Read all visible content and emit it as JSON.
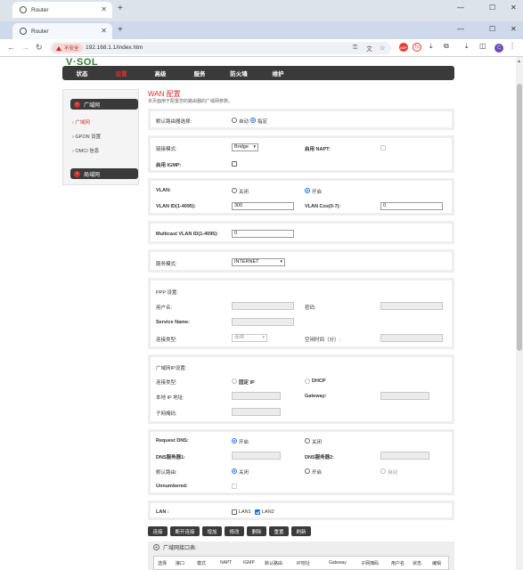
{
  "browser": {
    "tab_title": "Router",
    "url": "192.168.1.1/index.htm",
    "insecure_label": "不安全",
    "profile_initial": "C"
  },
  "router": {
    "logo": "V·SOL",
    "nav": [
      "状态",
      "设置",
      "高级",
      "服务",
      "防火墙",
      "维护"
    ],
    "sidebar": {
      "wan_header": "广域网",
      "items": [
        "广域网",
        "GPON 设置",
        "OMCI 信息"
      ],
      "lan_header": "局域网"
    },
    "page_title": "WAN 配置",
    "page_subtitle": "本页面用于配置您的路由器的广域网参数。",
    "default_route": {
      "label": "默认路由器选择:",
      "options": [
        "自动",
        "指定"
      ],
      "selected": "指定"
    },
    "mode": {
      "label": "链接模式:",
      "value": "Bridge",
      "napt_label": "启用 NAPT:",
      "igmp_label": "启用 IGMP:"
    },
    "vlan": {
      "label": "VLAN:",
      "off": "关闭",
      "on": "开启",
      "id_label": "VLAN ID(1-4095):",
      "id_value": "300",
      "cos_label": "VLAN Cos(0-7):",
      "cos_value": "0"
    },
    "multicast": {
      "label": "Multicast VLAN ID(1-4095):",
      "value": "0"
    },
    "service": {
      "label": "服务模式:",
      "value": "INTERNET"
    },
    "ppp": {
      "heading": "PPP 设置:",
      "user_label": "用户名:",
      "pass_label": "密码:",
      "service_name_label": "Service Name:",
      "conn_type_label": "连接类型:",
      "conn_type_value": "连续",
      "idle_label": "空闲时间（分）:"
    },
    "wanip": {
      "heading": "广域网IP设置:",
      "type_label": "连接类型:",
      "fixed": "固定 IP",
      "dhcp": "DHCP",
      "local_ip_label": "本地 IP 地址:",
      "gateway_label": "Gateway:",
      "mask_label": "子网掩码:"
    },
    "dns": {
      "request_label": "Request DNS:",
      "on": "开启",
      "off": "关闭",
      "dns1_label": "DNS服务器1:",
      "dns2_label": "DNS服务器2:",
      "default_route_label": "默认路由:",
      "dr_off": "关闭",
      "dr_on": "开启",
      "dr_auto": "自动",
      "unnumbered_label": "Unnumbered:"
    },
    "lan": {
      "label": "LAN :",
      "lan1": "LAN1",
      "lan2": "LAN2"
    },
    "buttons": [
      "连接",
      "断开连接",
      "增加",
      "修改",
      "删除",
      "重置",
      "刷新"
    ],
    "iface_table": {
      "title": "广域网接口表:",
      "columns": [
        "选择",
        "接口",
        "模式",
        "NAPT",
        "IGMP",
        "默认路由",
        "IP地址",
        "Gateway",
        "子网掩码",
        "用户名",
        "状态",
        "编辑"
      ]
    }
  }
}
